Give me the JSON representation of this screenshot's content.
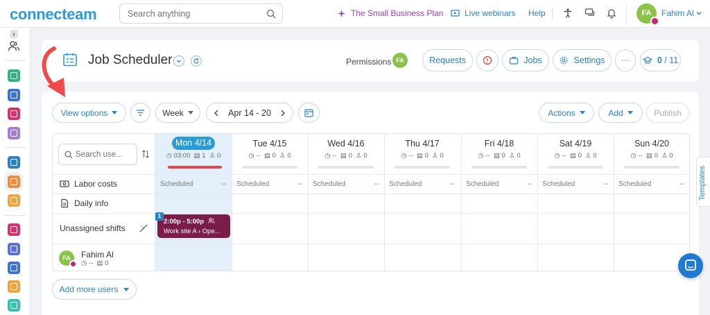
{
  "topbar": {
    "logo": "connecteam",
    "search_placeholder": "Search anything",
    "plan_link": "The Small Business Plan",
    "webinars_link": "Live webinars",
    "help_link": "Help",
    "user_initials": "FA",
    "user_name": "Fahim Al"
  },
  "header": {
    "title": "Job Scheduler",
    "permissions_label": "Permissions",
    "permissions_initials": "FA",
    "requests_label": "Requests",
    "jobs_label": "Jobs",
    "settings_label": "Settings",
    "more_label": "···",
    "onboarding_done": "0",
    "onboarding_total": "/ 11"
  },
  "toolbar": {
    "view_options": "View options",
    "week_label": "Week",
    "date_range": "Apr 14 - 20",
    "actions_label": "Actions",
    "add_label": "Add",
    "publish_label": "Publish"
  },
  "grid": {
    "search_placeholder": "Search use...",
    "days": [
      {
        "label": "Mon 4/14",
        "hours": "03:00",
        "shifts": "1",
        "users": "0",
        "today": true
      },
      {
        "label": "Tue 4/15",
        "hours": "--",
        "shifts": "0",
        "users": "0",
        "today": false
      },
      {
        "label": "Wed 4/16",
        "hours": "--",
        "shifts": "0",
        "users": "0",
        "today": false
      },
      {
        "label": "Thu 4/17",
        "hours": "--",
        "shifts": "0",
        "users": "0",
        "today": false
      },
      {
        "label": "Fri 4/18",
        "hours": "--",
        "shifts": "0",
        "users": "0",
        "today": false
      },
      {
        "label": "Sat 4/19",
        "hours": "--",
        "shifts": "0",
        "users": "0",
        "today": false
      },
      {
        "label": "Sun 4/20",
        "hours": "--",
        "shifts": "0",
        "users": "0",
        "today": false
      }
    ],
    "labor_costs_label": "Labor costs",
    "scheduled_label": "Scheduled",
    "scheduled_value": "--",
    "daily_info_label": "Daily info",
    "unassigned_label": "Unassigned shifts",
    "shift": {
      "badge": "1",
      "time": "2:00p - 5:00p",
      "site": "Work site A › Ope..."
    },
    "employee": {
      "initials": "FA",
      "name": "Fahim Al",
      "hours": "--",
      "shifts": "0"
    }
  },
  "add_users_label": "Add more users",
  "templates_tab": "Templates",
  "colors": {
    "brand": "#2b9bd8",
    "today_bar": "#e24747",
    "shift": "#7a1d4a",
    "avatar": "#8bc34a"
  }
}
